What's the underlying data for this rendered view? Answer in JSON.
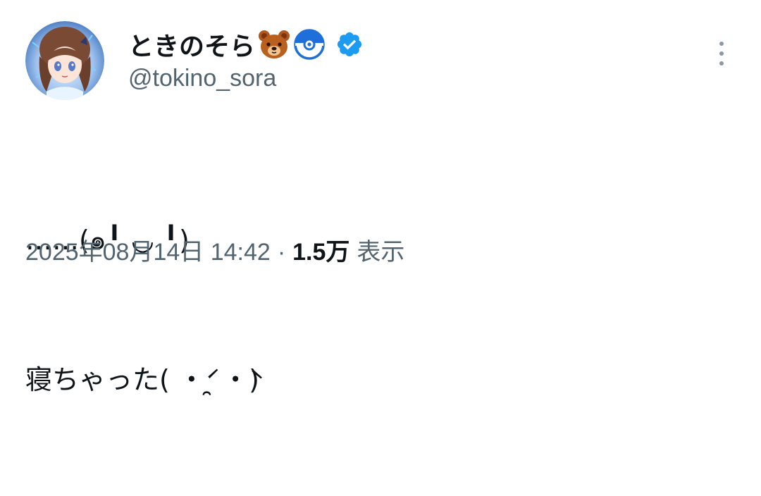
{
  "user": {
    "display_name": "ときのそら",
    "handle": "@tokino_sora",
    "emoji_icons": [
      "bear-face-emoji",
      "blue-circle-emoji"
    ],
    "verified_icon": "verified-badge-icon",
    "verified_color": "#1d9bf0"
  },
  "tweet": {
    "line1": "……(๑╹ ◡ ╹)",
    "line2": "寝ちゃった( ・́ ̯ ・̀)"
  },
  "meta": {
    "datetime": "2025年08月14日 14:42",
    "separator": "·",
    "views_count": "1.5万",
    "views_label": "表示"
  },
  "more_icon": "more-vertical-icon",
  "colors": {
    "text_primary": "#0f1419",
    "text_secondary": "#536471",
    "accent": "#1d9bf0"
  }
}
